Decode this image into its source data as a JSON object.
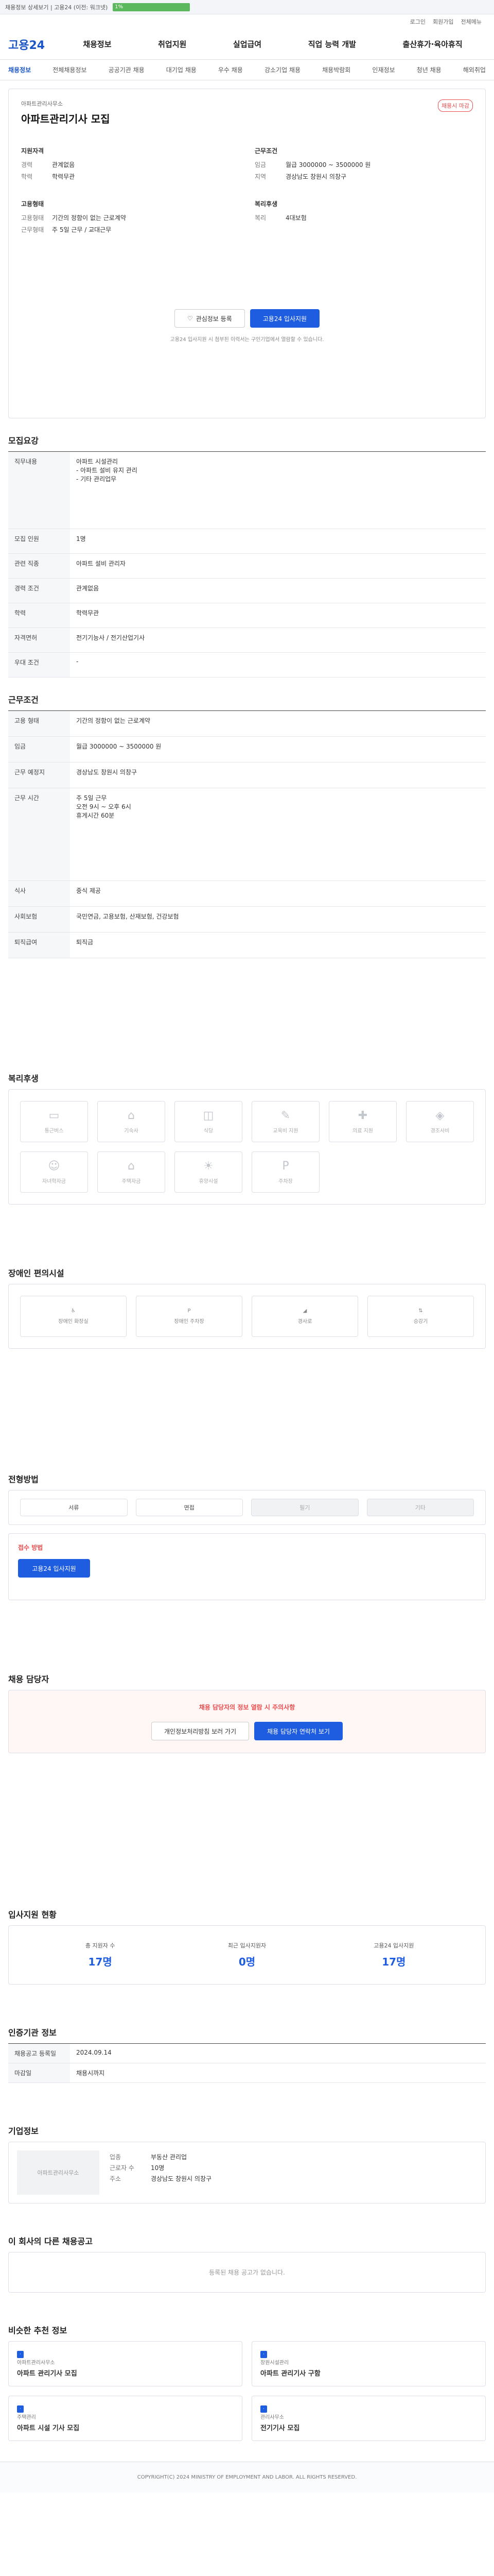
{
  "browser": {
    "label": "채용정보 상세보기 | 고용24 (이전: 워크넷)",
    "progress": "1%"
  },
  "util": [
    "로그인",
    "회원가입",
    "전체메뉴"
  ],
  "logo": "고용24",
  "menu": [
    "채용정보",
    "취업지원",
    "실업급여",
    "직업 능력 개발",
    "출산휴가·육아휴직"
  ],
  "lnb": [
    "채용정보",
    "전체채용정보",
    "공공기관 채용",
    "대기업 채용",
    "우수 채용",
    "강소기업 채용",
    "채용박람회",
    "인재정보",
    "청년 채용",
    "해외취업"
  ],
  "header": {
    "company": "아파트관리사무소",
    "title": "아파트관리기사 모집",
    "tag": "채용시 마감",
    "left_title": "지원자격",
    "left_rows": [
      [
        "경력",
        "관계없음"
      ],
      [
        "학력",
        "학력무관"
      ]
    ],
    "right_title": "근무조건",
    "right_rows": [
      [
        "임금",
        "월급 3000000 ~ 3500000 원"
      ],
      [
        "지역",
        "경상남도 창원시 의창구"
      ]
    ],
    "left2_title": "고용형태",
    "left2_rows": [
      [
        "고용형태",
        "기간의 정함이 없는 근로계약"
      ],
      [
        "근무형태",
        "주 5일 근무 / 교대근무"
      ]
    ],
    "right2_title": "복리후생",
    "right2_rows": [
      [
        "복리",
        "4대보험"
      ]
    ],
    "btn_interest": "관심정보 등록",
    "btn_apply": "고용24 입사지원",
    "notice": "고용24 입사지원 시 첨부된 이력서는 구인기업에서 열람할 수 있습니다."
  },
  "recruit": {
    "title": "모집요강",
    "rows": [
      [
        "직무내용",
        "아파트 시설관리\n- 아파트 설비 유지 관리\n- 기타 관리업무"
      ],
      [
        "모집 인원",
        "1명"
      ],
      [
        "관련 직종",
        "아파트 설비 관리자"
      ],
      [
        "경력 조건",
        "관계없음"
      ],
      [
        "학력",
        "학력무관"
      ],
      [
        "자격면허",
        "전기기능사 / 전기산업기사"
      ],
      [
        "우대 조건",
        "-"
      ]
    ]
  },
  "work": {
    "title": "근무조건",
    "rows": [
      [
        "고용 형태",
        "기간의 정함이 없는 근로계약"
      ],
      [
        "임금",
        "월급 3000000 ~ 3500000 원"
      ],
      [
        "근무 예정지",
        "경상남도 창원시 의창구"
      ],
      [
        "근무 시간",
        "주 5일 근무\n오전 9시 ~ 오후 6시\n휴게시간 60분"
      ],
      [
        "식사",
        "중식 제공"
      ],
      [
        "사회보험",
        "국민연금, 고용보험, 산재보험, 건강보험"
      ],
      [
        "퇴직급여",
        "퇴직금"
      ]
    ]
  },
  "benefit": {
    "title": "복리후생",
    "items": [
      "통근버스",
      "기숙사",
      "식당",
      "교육비 지원",
      "의료 지원",
      "경조사비",
      "자녀학자금",
      "주택자금",
      "휴양시설",
      "주차장"
    ]
  },
  "disability": {
    "title": "장애인 편의시설",
    "items": [
      "장애인 화장실",
      "장애인 주차장",
      "경사로",
      "승강기"
    ]
  },
  "process": {
    "title": "전형방법",
    "steps": [
      "서류",
      "면접",
      "필기",
      "기타"
    ],
    "apply_title": "접수 방법",
    "apply": "고용24 입사지원"
  },
  "contact": {
    "title": "채용 담당자",
    "notice": "채용 담당자의 정보 열람 시 주의사항",
    "btn1": "개인정보처리방침 보러 가기",
    "btn2": "채용 담당자 연락처 보기"
  },
  "stats": {
    "title": "입사지원 현황",
    "items": [
      [
        "총 지원자 수",
        "17명"
      ],
      [
        "최근 입사지원자",
        "0명"
      ],
      [
        "고용24 입사지원",
        "17명"
      ]
    ]
  },
  "agency": {
    "title": "인증기관 정보",
    "rows": [
      [
        "채용공고 등록일",
        "2024.09.14"
      ],
      [
        "마감일",
        "채용시까지"
      ]
    ]
  },
  "company": {
    "title": "기업정보",
    "name": "아파트관리사무소",
    "rows": [
      [
        "업종",
        "부동산 관리업"
      ],
      [
        "근로자 수",
        "10명"
      ],
      [
        "주소",
        "경상남도 창원시 의창구"
      ]
    ]
  },
  "others": {
    "title": "이 회사의 다른 채용공고",
    "empty": "등록된 채용 공고가 없습니다."
  },
  "similar": {
    "title": "비슷한 추천 정보",
    "cards": [
      [
        "아파트관리사무소",
        "아파트 관리기사 모집"
      ],
      [
        "창원시설관리",
        "아파트 관리기사 구함"
      ],
      [
        "주택관리",
        "아파트 시설 기사 모집"
      ],
      [
        "관리사무소",
        "전기기사 모집"
      ]
    ]
  },
  "footer": "COPYRIGHT(C) 2024 MINISTRY OF EMPLOYMENT AND LABOR. ALL RIGHTS RESERVED."
}
